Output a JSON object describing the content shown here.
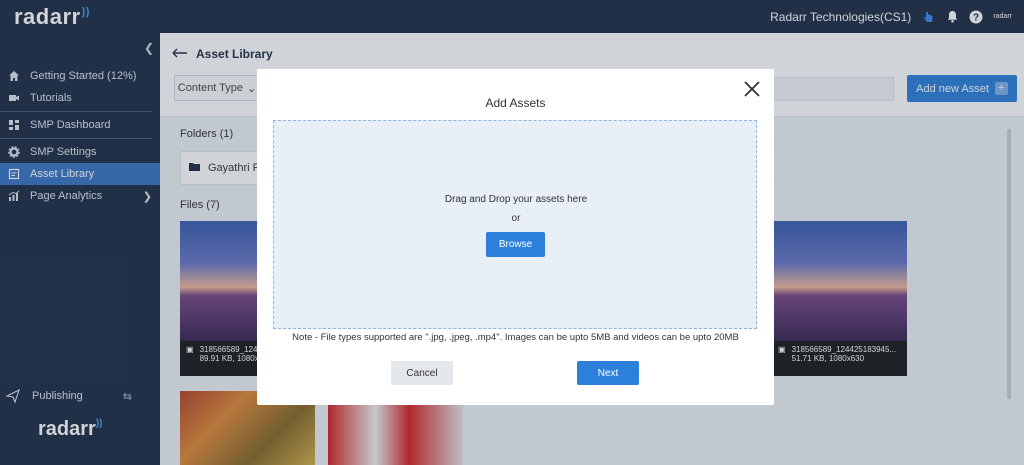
{
  "topbar": {
    "brand": "radarr",
    "org_name": "Radarr Technologies(CS1)",
    "avatar_text": "radarr"
  },
  "sidebar": {
    "items": [
      {
        "label": "Getting Started (12%)",
        "icon": "home-icon"
      },
      {
        "label": "Tutorials",
        "icon": "video-icon"
      },
      {
        "label": "SMP Dashboard",
        "icon": "dashboard-icon"
      },
      {
        "label": "SMP Settings",
        "icon": "gear-icon"
      },
      {
        "label": "Asset Library",
        "icon": "library-icon",
        "active": true
      },
      {
        "label": "Page Analytics",
        "icon": "chart-icon"
      }
    ],
    "publishing_label": "Publishing",
    "logo_text": "radarr"
  },
  "main": {
    "title": "Asset Library",
    "filter_label": "Content Type",
    "add_button_label": "Add new Asset",
    "folders_label": "Folders (1)",
    "folder_name": "Gayathri File",
    "files_label": "Files (7)",
    "files": [
      {
        "name": "318566589_124",
        "info": "89.91 KB, 1080x"
      },
      {
        "name": "318566589_124425183945...",
        "info": "51.71 KB, 1080x630"
      }
    ]
  },
  "modal": {
    "title": "Add Assets",
    "drop_text": "Drag and Drop your assets here",
    "or_text": "or",
    "browse_label": "Browse",
    "note": "Note - File types supported are \".jpg, .jpeg, .mp4\". Images can be upto 5MB and videos can be upto 20MB",
    "cancel_label": "Cancel",
    "next_label": "Next"
  },
  "colors": {
    "sidebar_bg": "#1f2f46",
    "accent": "#2c80d9",
    "active_item": "#3a76c4"
  }
}
